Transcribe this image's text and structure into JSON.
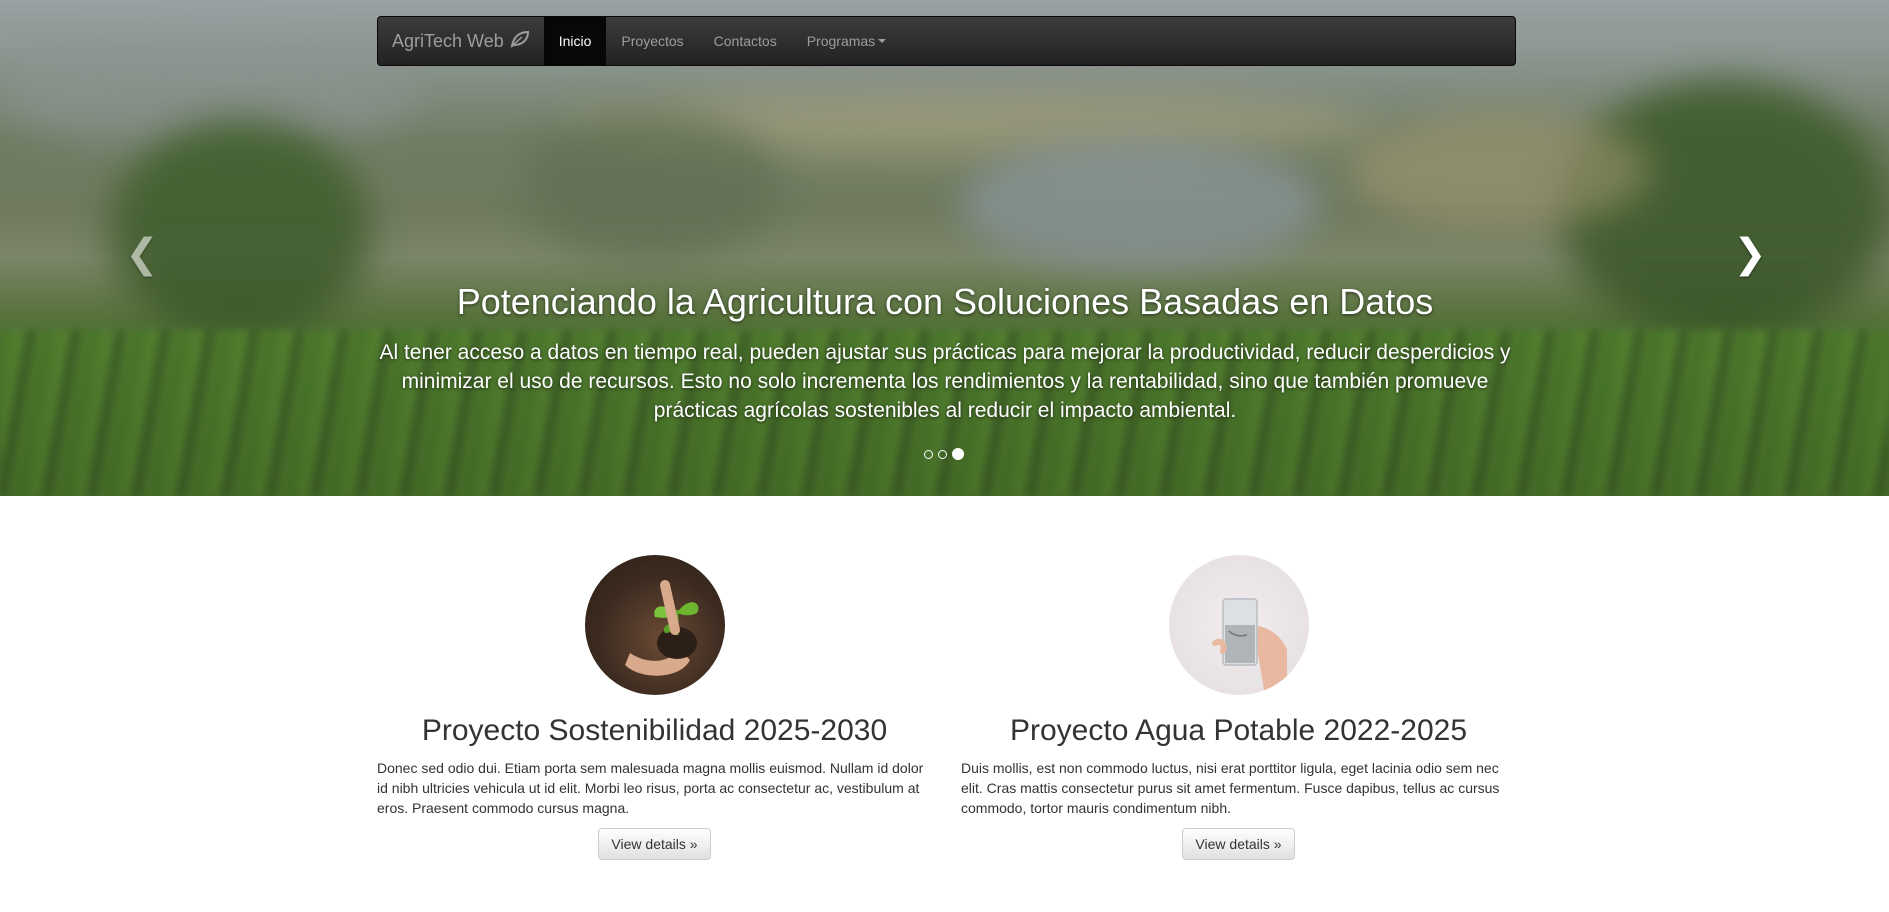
{
  "navbar": {
    "brand": "AgriTech Web",
    "brand_icon": "leaf-icon",
    "items": [
      {
        "label": "Inicio",
        "active": true
      },
      {
        "label": "Proyectos",
        "active": false
      },
      {
        "label": "Contactos",
        "active": false
      },
      {
        "label": "Programas",
        "active": false,
        "dropdown": true
      }
    ]
  },
  "carousel": {
    "title": "Potenciando la Agricultura con Soluciones Basadas en Datos",
    "text": "Al tener acceso a datos en tiempo real, pueden ajustar sus prácticas para mejorar la productividad, reducir desperdicios y minimizar el uso de recursos. Esto no solo incrementa los rendimientos y la rentabilidad, sino que también promueve prácticas agrícolas sostenibles al reducir el impacto ambiental.",
    "prev_icon": "chevron-left-icon",
    "next_icon": "chevron-right-icon",
    "slides_count": 3,
    "active_slide": 3
  },
  "projects": [
    {
      "title": "Proyecto Sostenibilidad 2025-2030",
      "text": "Donec sed odio dui. Etiam porta sem malesuada magna mollis euismod. Nullam id dolor id nibh ultricies vehicula ut id elit. Morbi leo risus, porta ac consectetur ac, vestibulum at eros. Praesent commodo cursus magna.",
      "button": "View details »"
    },
    {
      "title": "Proyecto Agua Potable 2022-2025",
      "text": "Duis mollis, est non commodo luctus, nisi erat porttitor ligula, eget lacinia odio sem nec elit. Cras mattis consectetur purus sit amet fermentum. Fusce dapibus, tellus ac cursus commodo, tortor mauris condimentum nibh.",
      "button": "View details »"
    }
  ]
}
